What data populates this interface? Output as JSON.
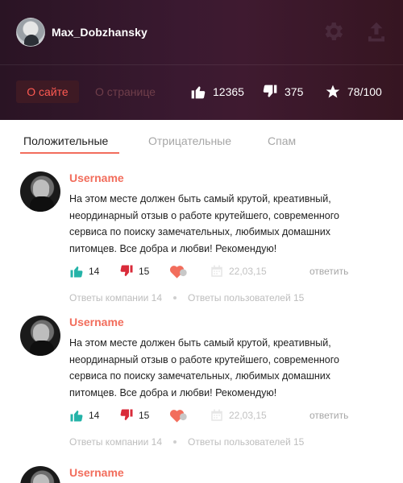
{
  "profile": {
    "username": "Max_Dobzhansky"
  },
  "header": {
    "tabs": [
      "О сайте",
      "О странице"
    ],
    "stats": {
      "likes": "12365",
      "dislikes": "375",
      "rating": "78/100"
    }
  },
  "review_tabs": [
    "Положительные",
    "Отрицательные",
    "Спам"
  ],
  "reviews": [
    {
      "name": "Username",
      "text": "На этом месте должен быть самый крутой, креативный, неординарный отзыв о работе крутейшего, современного сервиса по поиску замечательных, любимых домашних питомцев. Все добра и любви! Рекомендую!",
      "likes": "14",
      "dislikes": "15",
      "date": "22,03,15",
      "reply_label": "ответить",
      "company_replies": "Ответы компании 14",
      "user_replies": "Ответы пользователей 15"
    },
    {
      "name": "Username",
      "text": "На этом месте должен быть самый крутой, креативный, неординарный отзыв о работе крутейшего, современного сервиса по поиску замечательных, любимых домашних питомцев. Все добра и любви! Рекомендую!",
      "likes": "14",
      "dislikes": "15",
      "date": "22,03,15",
      "reply_label": "ответить",
      "company_replies": "Ответы компании 14",
      "user_replies": "Ответы пользователей 15"
    },
    {
      "name": "Username"
    }
  ],
  "colors": {
    "accent": "#f26d5c",
    "like": "#24b3a8",
    "dislike": "#d92b3a",
    "header_bg": "#3a1930"
  },
  "icons": [
    "gear-icon",
    "upload-icon",
    "thumbs-up-icon",
    "thumbs-down-icon",
    "star-icon",
    "heart-icon",
    "calendar-icon"
  ]
}
